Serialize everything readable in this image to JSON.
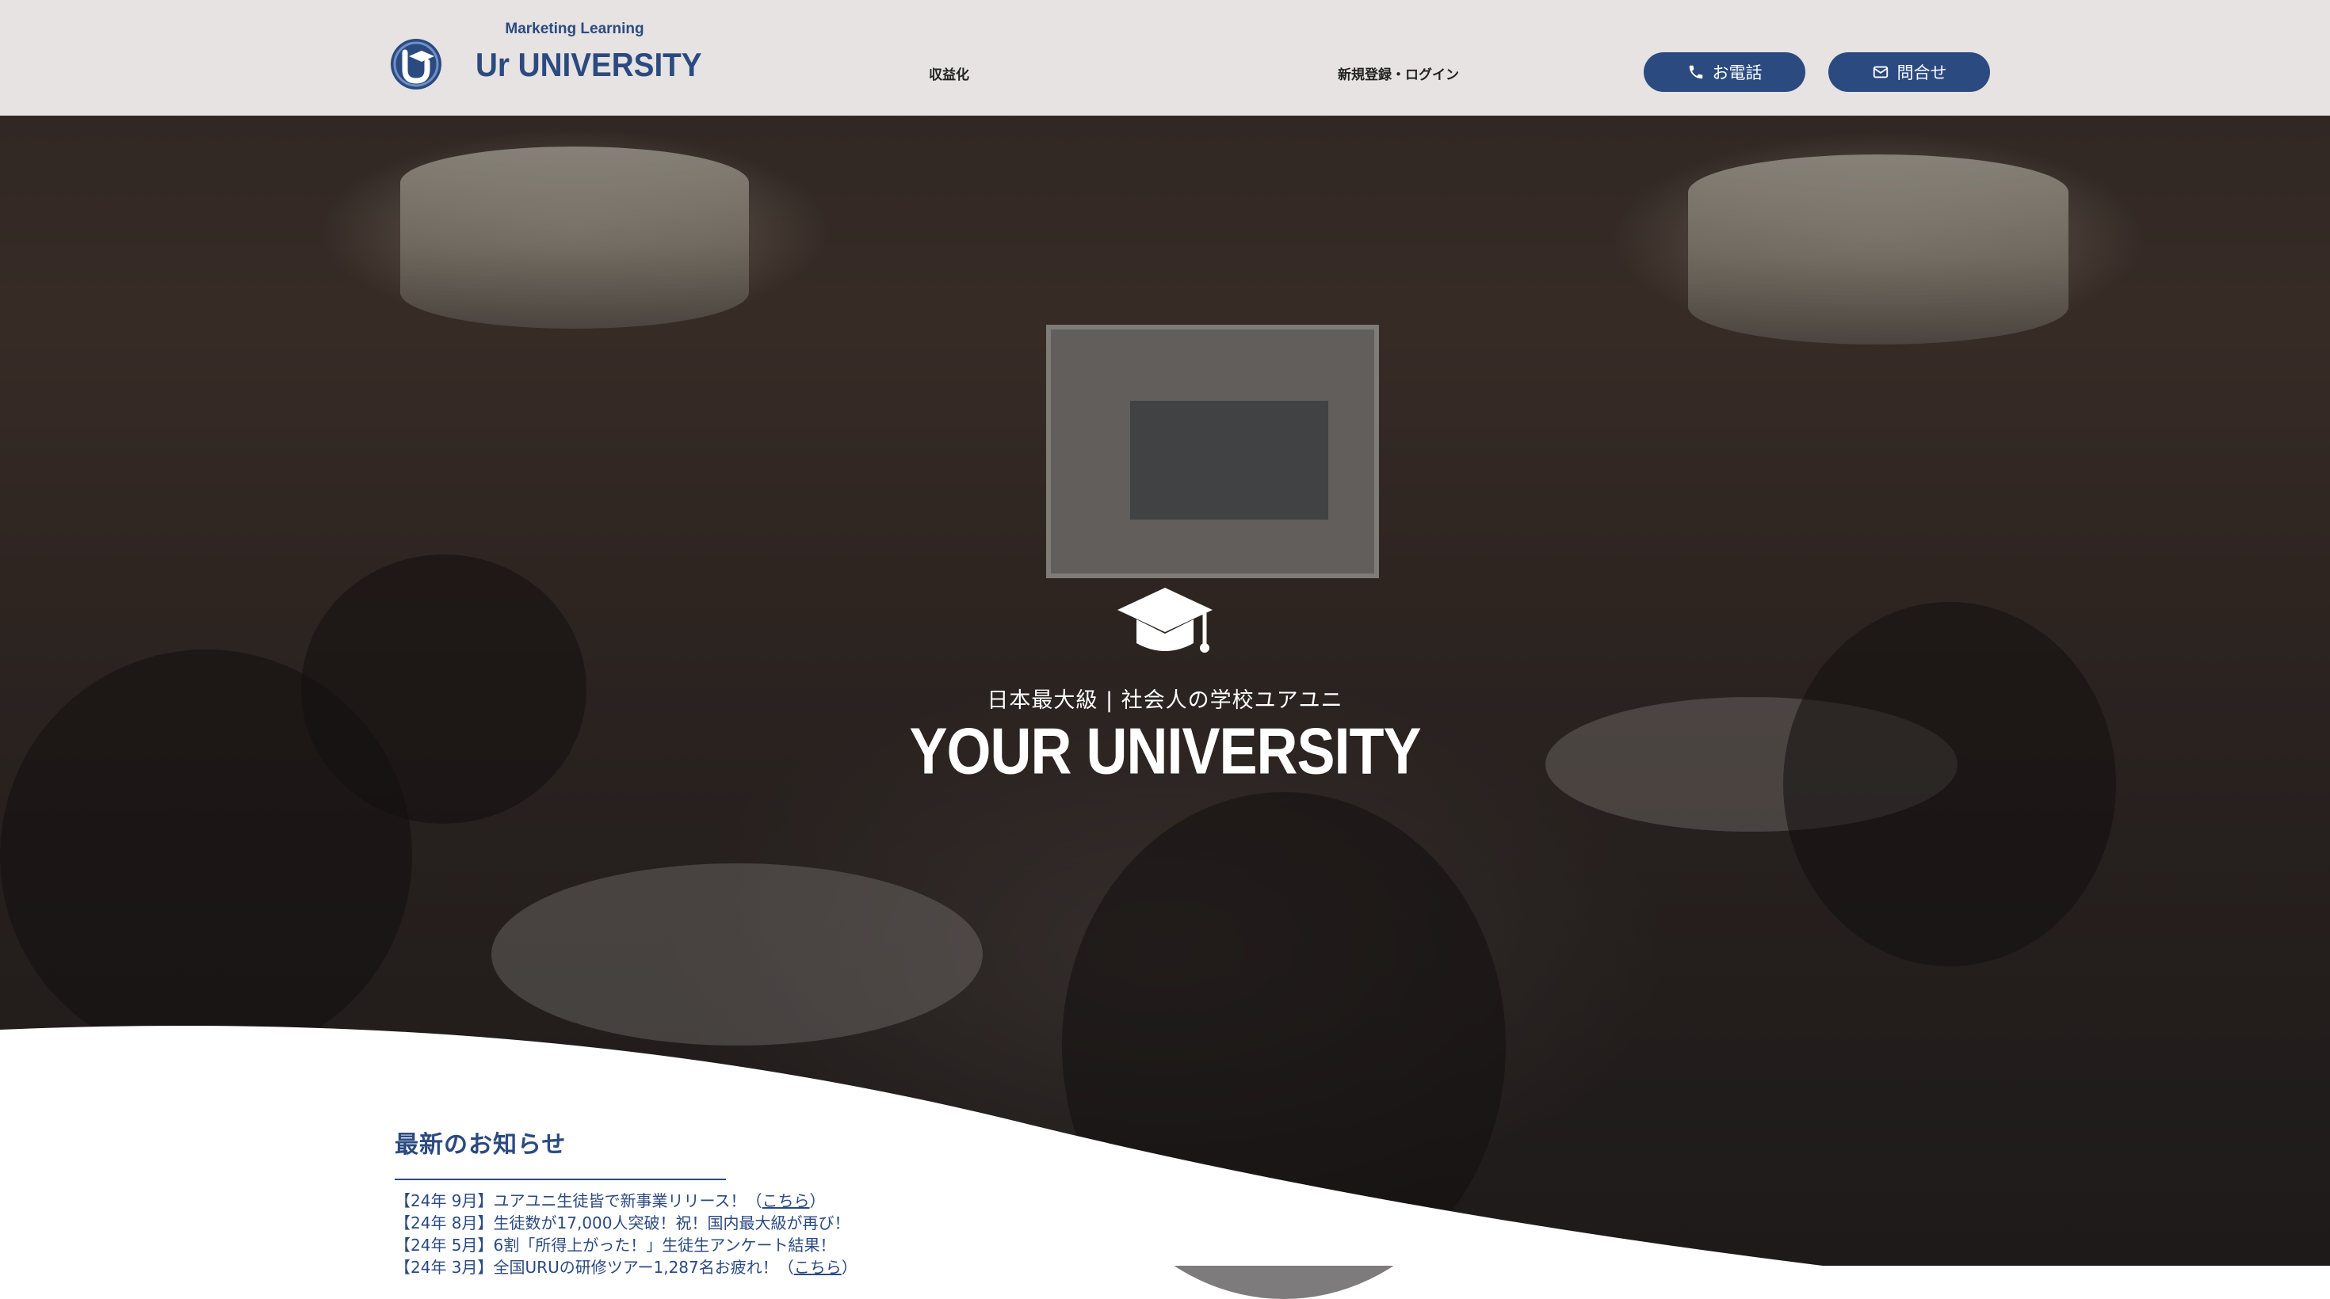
{
  "header": {
    "logo_subtitle": "Marketing Learning",
    "logo_title": "Ur UNIVERSITY",
    "nav": {
      "monetize": "収益化",
      "register_login": "新規登録・ログイン"
    },
    "phone_button": "お電話",
    "contact_button": "問合せ"
  },
  "hero": {
    "tagline": "日本最大級 | 社会人の学校ユアユニ",
    "title": "YOUR UNIVERSITY",
    "icon": "graduation-cap-icon"
  },
  "news": {
    "title": "最新のお知らせ",
    "items": [
      {
        "text": "【24年 9月】ユアユニ生徒皆で新事業リリース！（",
        "link": "こちら",
        "suffix": "）"
      },
      {
        "text": "【24年 8月】生徒数が17,000人突破！祝！国内最大級が再び！",
        "link": "",
        "suffix": ""
      },
      {
        "text": "【24年 5月】6割「所得上がった！」生徒生アンケート結果！",
        "link": "",
        "suffix": ""
      },
      {
        "text": "【24年 3月】全国URUの研修ツアー1,287名お疲れ！（",
        "link": "こちら",
        "suffix": "）"
      }
    ]
  },
  "colors": {
    "brand": "#2b4a80",
    "header_bg": "#ece9e8",
    "hero_text": "#ffffff"
  },
  "icons": {
    "phone": "phone-icon",
    "mail": "mail-icon",
    "logo": "ur-logo-icon"
  }
}
